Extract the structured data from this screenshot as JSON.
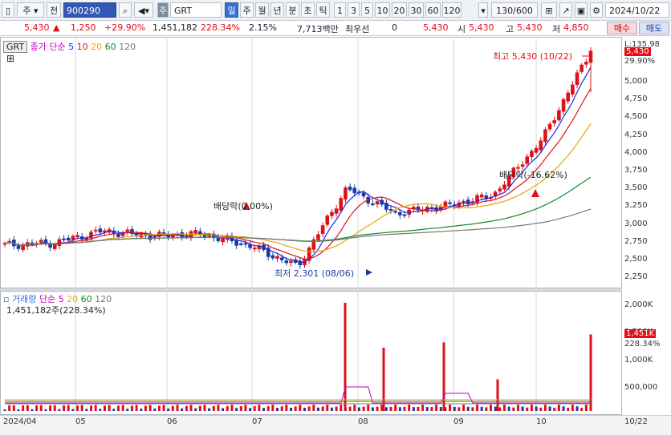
{
  "toolbar": {
    "type_select": "주",
    "prefix_label": "전",
    "code": "900290",
    "name": "GRT",
    "market_tag": "주",
    "periods": [
      "일",
      "주",
      "월",
      "년",
      "분",
      "초",
      "틱"
    ],
    "numbers": [
      "1",
      "3",
      "5",
      "10",
      "20",
      "30",
      "60",
      "120"
    ],
    "count": "130/600",
    "date": "2024/10/22"
  },
  "info": {
    "price": "5,430",
    "change": "1,250",
    "pct": "+29.90%",
    "volume": "1,451,182",
    "vol_ratio": "228.34%",
    "turnover": "2.15%",
    "amount": "7,713백만",
    "pref_label": "최우선",
    "pref_value": "0",
    "current": "5,430",
    "open_label": "시",
    "open": "5,430",
    "high_label": "고",
    "high": "5,430",
    "low_label": "저",
    "low": "4,850",
    "buy": "매수",
    "sell": "매도"
  },
  "price_pane": {
    "symbol": "GRT",
    "legend_title": "종가 단순",
    "ma_periods": [
      "5",
      "10",
      "20",
      "60",
      "120"
    ],
    "ma_colors": [
      "#1b2ae0",
      "#e0101a",
      "#e8a500",
      "#0a8a2a",
      "#777777"
    ],
    "y_ticks": [
      "5,000",
      "4,750",
      "4,500",
      "4,250",
      "4,000",
      "3,750",
      "3,500",
      "3,250",
      "3,000",
      "2,750",
      "2,500",
      "2,250"
    ],
    "top_label": "L:135.98",
    "last_price": "5,430",
    "last_pct": "29.90%",
    "high_note": "최고 5,430 (10/22)",
    "low_note": "최저 2,301 (08/06)",
    "div_note1": "배당락(0.00%)",
    "div_note2": "배당락(-16.62%)"
  },
  "volume_pane": {
    "title": "거래량",
    "legend_title": "단순",
    "ma_periods": [
      "5",
      "20",
      "60",
      "120"
    ],
    "ma_colors": [
      "#c000c0",
      "#e8a500",
      "#0a8a2a",
      "#777777"
    ],
    "subtitle": "1,451,182주(228.34%)",
    "y_ticks": [
      "2,000K",
      "1,500K",
      "1,000K",
      "500,000"
    ],
    "last_vol": "1,451K",
    "last_pct": "228.34%"
  },
  "x_axis": [
    "2024/04",
    "05",
    "06",
    "07",
    "08",
    "09",
    "10",
    "10/22"
  ],
  "chart_data": {
    "type": "candlestick",
    "title": "GRT",
    "ylim": [
      2200,
      5450
    ],
    "x": [
      "04",
      "05",
      "06",
      "07",
      "08",
      "09",
      "10",
      "10/22"
    ],
    "series": [
      {
        "name": "close",
        "values": [
          2700,
          2730,
          2900,
          2830,
          2860,
          2700,
          2400,
          3500,
          3150,
          3250,
          3400,
          4180,
          5430
        ]
      },
      {
        "name": "volume",
        "values": [
          80000,
          120000,
          90000,
          60000,
          2050000,
          200000,
          1200000,
          1300000,
          100000,
          150000,
          600000,
          1451182
        ]
      }
    ],
    "high": 5430,
    "high_date": "10/22",
    "low": 2301,
    "low_date": "08/06"
  }
}
